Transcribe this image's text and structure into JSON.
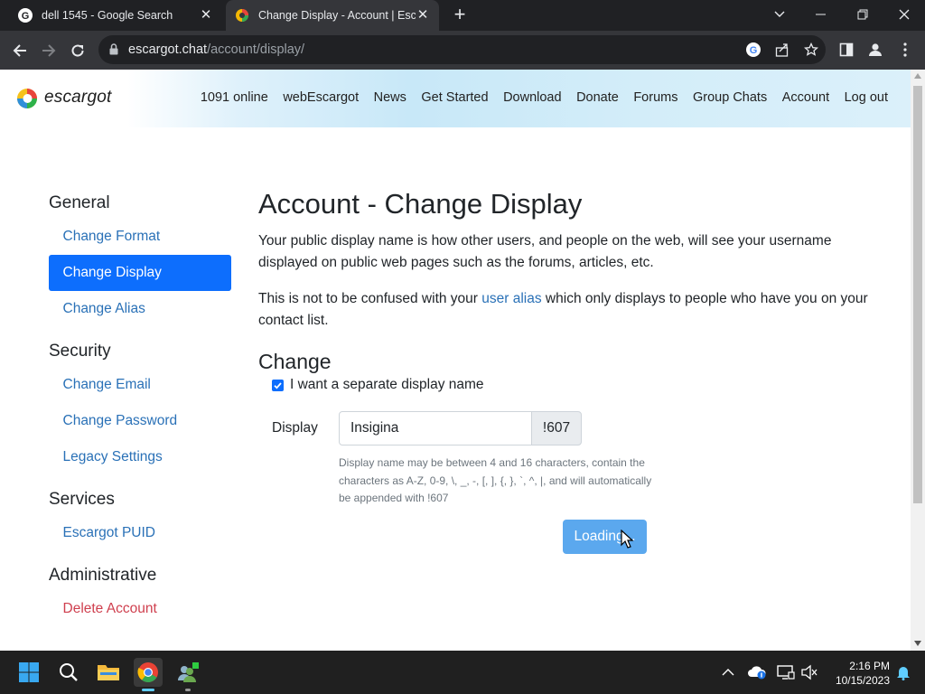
{
  "browser": {
    "tabs": [
      {
        "title": "dell 1545 - Google Search",
        "close": "✕"
      },
      {
        "title": "Change Display - Account | Escargot",
        "close": "✕"
      }
    ],
    "new_tab": "+",
    "url_host": "escargot.chat",
    "url_path": "/account/display/"
  },
  "site": {
    "brand": "escargot",
    "nav": [
      "1091 online",
      "webEscargot",
      "News",
      "Get Started",
      "Download",
      "Donate",
      "Forums",
      "Group Chats",
      "Account",
      "Log out"
    ]
  },
  "sidebar": {
    "general": "General",
    "change_format": "Change Format",
    "change_display": "Change Display",
    "change_alias": "Change Alias",
    "security": "Security",
    "change_email": "Change Email",
    "change_password": "Change Password",
    "legacy_settings": "Legacy Settings",
    "services": "Services",
    "escargot_puid": "Escargot PUID",
    "administrative": "Administrative",
    "delete_account": "Delete Account"
  },
  "main": {
    "title": "Account - Change Display",
    "para1": "Your public display name is how other users, and people on the web, will see your username displayed on public web pages such as the forums, articles, etc.",
    "para2_before": "This is not to be confused with your ",
    "para2_link": "user alias",
    "para2_after": " which only displays to people who have you on your contact list.",
    "section": "Change",
    "checkbox_label": "I want a separate display name",
    "checkbox_checked": true,
    "display_label": "Display",
    "display_value": "Insigina",
    "suffix": "!607",
    "help": "Display name may be between 4 and 16 characters, contain the characters as A-Z, 0-9, \\, _, -, [, ], {, }, `, ^, |, and will automatically be appended with !607",
    "button": "Loading..."
  },
  "taskbar": {
    "time": "2:16 PM",
    "date": "10/15/2023"
  },
  "colors": {
    "accent": "#0d6efd",
    "link": "#2a71b7",
    "danger": "#cf3f4e"
  }
}
